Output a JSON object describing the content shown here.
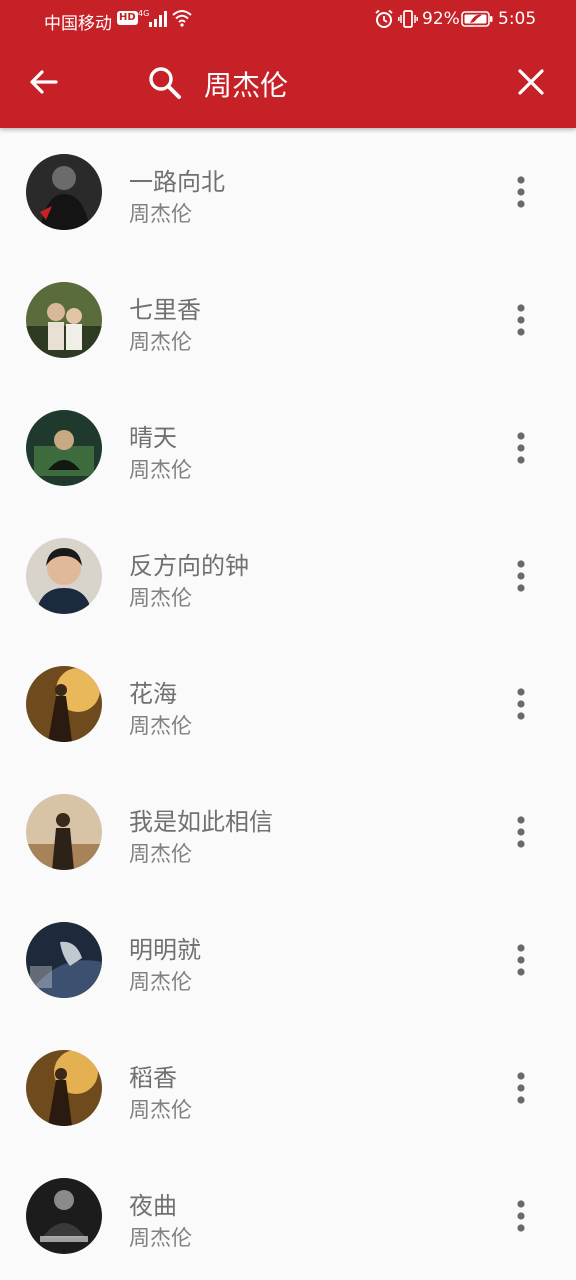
{
  "status_bar": {
    "carrier": "中国移动",
    "hd": "HD",
    "battery_percent": "92%",
    "time": "5:05",
    "icons": [
      "signal-icon",
      "wifi-icon",
      "alarm-icon",
      "vibrate-icon",
      "battery-icon"
    ]
  },
  "search": {
    "query": "周杰伦",
    "icons": [
      "back-arrow-icon",
      "search-icon",
      "close-icon"
    ]
  },
  "colors": {
    "header": "#c62127",
    "background": "#fafafa",
    "title_text": "#707070",
    "artist_text": "#808080"
  },
  "results": [
    {
      "title": "一路向北",
      "artist": "周杰伦"
    },
    {
      "title": "七里香",
      "artist": "周杰伦"
    },
    {
      "title": "晴天",
      "artist": "周杰伦"
    },
    {
      "title": "反方向的钟",
      "artist": "周杰伦"
    },
    {
      "title": "花海",
      "artist": "周杰伦"
    },
    {
      "title": "我是如此相信",
      "artist": "周杰伦"
    },
    {
      "title": "明明就",
      "artist": "周杰伦"
    },
    {
      "title": "稻香",
      "artist": "周杰伦"
    },
    {
      "title": "夜曲",
      "artist": "周杰伦"
    }
  ]
}
